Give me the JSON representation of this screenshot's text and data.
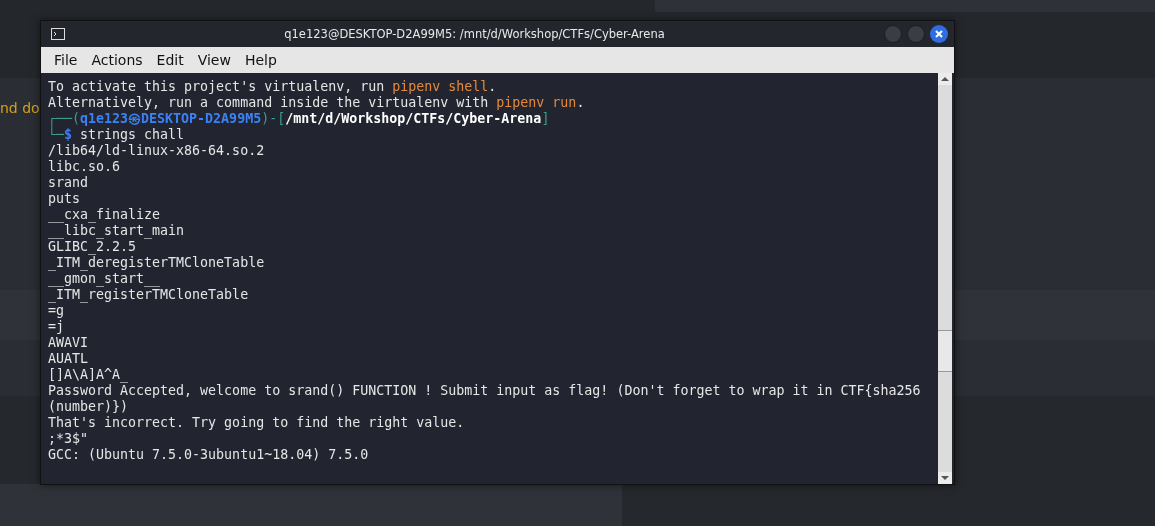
{
  "background": {
    "snippet": "nd do"
  },
  "window": {
    "title": "q1e123@DESKTOP-D2A99M5: /mnt/d/Workshop/CTFs/Cyber-Arena"
  },
  "menu": [
    "File",
    "Actions",
    "Edit",
    "View",
    "Help"
  ],
  "terminal": {
    "lines": [
      {
        "parts": [
          {
            "text": "To activate this project's virtualenv, run ",
            "kind": "plain"
          },
          {
            "text": "pipenv shell",
            "kind": "accent"
          },
          {
            "text": ".",
            "kind": "plain"
          }
        ]
      },
      {
        "parts": [
          {
            "text": "Alternatively, run a command inside the virtualenv with ",
            "kind": "plain"
          },
          {
            "text": "pipenv run",
            "kind": "accent"
          },
          {
            "text": ".",
            "kind": "plain"
          }
        ]
      },
      {
        "parts": [
          {
            "text": "┌──(",
            "kind": "frame"
          },
          {
            "text": "q1e123㉿DESKTOP-D2A99M5",
            "kind": "user"
          },
          {
            "text": ")-[",
            "kind": "frame"
          },
          {
            "text": "/mnt/d/Workshop/CTFs/Cyber-Arena",
            "kind": "path"
          },
          {
            "text": "]",
            "kind": "frame"
          }
        ]
      },
      {
        "parts": [
          {
            "text": "└─",
            "kind": "frame"
          },
          {
            "text": "$",
            "kind": "user"
          },
          {
            "text": " strings chall",
            "kind": "plain"
          }
        ]
      },
      {
        "parts": [
          {
            "text": "/lib64/ld-linux-x86-64.so.2",
            "kind": "plain"
          }
        ]
      },
      {
        "parts": [
          {
            "text": "libc.so.6",
            "kind": "plain"
          }
        ]
      },
      {
        "parts": [
          {
            "text": "srand",
            "kind": "plain"
          }
        ]
      },
      {
        "parts": [
          {
            "text": "puts",
            "kind": "plain"
          }
        ]
      },
      {
        "parts": [
          {
            "text": "__cxa_finalize",
            "kind": "plain"
          }
        ]
      },
      {
        "parts": [
          {
            "text": "__libc_start_main",
            "kind": "plain"
          }
        ]
      },
      {
        "parts": [
          {
            "text": "GLIBC_2.2.5",
            "kind": "plain"
          }
        ]
      },
      {
        "parts": [
          {
            "text": "_ITM_deregisterTMCloneTable",
            "kind": "plain"
          }
        ]
      },
      {
        "parts": [
          {
            "text": "__gmon_start__",
            "kind": "plain"
          }
        ]
      },
      {
        "parts": [
          {
            "text": "_ITM_registerTMCloneTable",
            "kind": "plain"
          }
        ]
      },
      {
        "parts": [
          {
            "text": "=g",
            "kind": "plain"
          }
        ]
      },
      {
        "parts": [
          {
            "text": "=j",
            "kind": "plain"
          }
        ]
      },
      {
        "parts": [
          {
            "text": "AWAVI",
            "kind": "plain"
          }
        ]
      },
      {
        "parts": [
          {
            "text": "AUATL",
            "kind": "plain"
          }
        ]
      },
      {
        "parts": [
          {
            "text": "[]A\\A]A^A_",
            "kind": "plain"
          }
        ]
      },
      {
        "parts": [
          {
            "text": "Password Accepted, welcome to srand() FUNCTION ! Submit input as flag! (Don't forget to wrap it in CTF{sha256(number)})",
            "kind": "plain"
          }
        ]
      },
      {
        "parts": [
          {
            "text": "That's incorrect. Try going to find the right value.",
            "kind": "plain"
          }
        ]
      },
      {
        "parts": [
          {
            "text": ";*3$\"",
            "kind": "plain"
          }
        ]
      },
      {
        "parts": [
          {
            "text": "GCC: (Ubuntu 7.5.0-3ubuntu1~18.04) 7.5.0",
            "kind": "plain"
          }
        ]
      }
    ]
  }
}
